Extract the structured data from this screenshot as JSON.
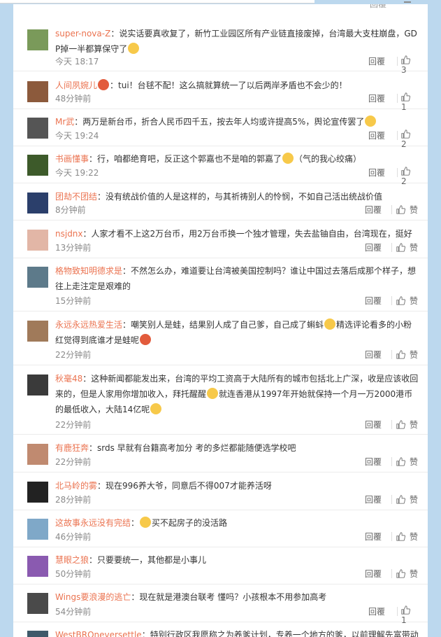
{
  "comments": [
    {
      "name": "super-nova-Z",
      "text": "：说实话要真收复了，新竹工业园区所有产业链直接废掉，台湾最大支柱崩盘，GDP掉一半都算保守了",
      "time": "今天 18:17",
      "reply": "回覆",
      "likes": "3",
      "avatar_color": "#7a9a5a",
      "emoji": "cry"
    },
    {
      "name": "人间夙婉儿",
      "text": "：tui！台毬不配！这么搞就算统一了以后两岸矛盾也不会少的！",
      "time": "48分钟前",
      "reply": "回覆",
      "likes": "1",
      "avatar_color": "#8c5a3c",
      "badge": "vip"
    },
    {
      "name": "Mr武",
      "text": "：两万是新台币，折合人民币四千五，按去年人均或许提高5%，舆论宣传罢了",
      "time": "今天 19:24",
      "reply": "回覆",
      "likes": "2",
      "avatar_color": "#555555",
      "emoji": "sad"
    },
    {
      "name": "书画懂事",
      "text": "：行，咱都绝育吧，反正这个郭嘉也不是咱的郭嘉了",
      "tail": "（气的我心绞痛）",
      "time": "今天 19:22",
      "reply": "回覆",
      "likes": "2",
      "avatar_color": "#3d5a2a",
      "emoji": "smile"
    },
    {
      "name": "团劫不团结",
      "text": "：没有统战价值的人是这样的，与其祈祷别人的怜悯，不如自己活出统战价值",
      "time": "8分钟前",
      "reply": "回覆",
      "likes": "赞",
      "avatar_color": "#2b3f6b"
    },
    {
      "name": "nsjdnx",
      "text": "：人家才看不上这2万台币，用2万台币换一个独才管理，失去盐铀自由，台湾现在，挺好",
      "time": "13分钟前",
      "reply": "回覆",
      "likes": "赞",
      "avatar_color": "#e2b6a6"
    },
    {
      "name": "格物致知明德求是",
      "text": "：不然怎么办，难道要让台湾被美国控制吗？谁让中国过去落后成那个样子，想往上走注定是艰难的",
      "time": "15分钟前",
      "reply": "回覆",
      "likes": "赞",
      "avatar_color": "#5d7a8a"
    },
    {
      "name": "永远永远热爱生活",
      "text": "：嘲笑别人是蛙，结果别人成了自己爹，自己成了蝌蚪",
      "text2": "精选评论看多的小粉红觉得到底谁才是蛙呢",
      "time": "22分钟前",
      "reply": "回覆",
      "likes": "赞",
      "avatar_color": "#a07a5a",
      "emoji": "laugh",
      "emoji2": "frog"
    },
    {
      "name": "秋毫48",
      "text": "：这种新闻都能发出来，台湾的平均工资高于大陆所有的城市包括北上广深，收是应该收回来的，但是人家用你增加收入，拜托醒醒",
      "text2": "就连香港从1997年开始就保持一个月一万2000港币的最低收入，大陆14亿呢",
      "time": "22分钟前",
      "reply": "回覆",
      "likes": "赞",
      "avatar_color": "#3a3a3a",
      "emoji": "laugh",
      "emoji2": "cry"
    },
    {
      "name": "有鹿狂奔",
      "text": "：srds 早就有台籍高考加分 考的多烂都能随便选学校吧",
      "time": "22分钟前",
      "reply": "回覆",
      "likes": "赞",
      "avatar_color": "#c08a70"
    },
    {
      "name": "北马岭的雾",
      "text": "：现在996养大爷，同意后不得007才能养活呀",
      "time": "28分钟前",
      "reply": "回覆",
      "likes": "赞",
      "avatar_color": "#222222"
    },
    {
      "name": "这故事永远没有完结",
      "text": "：",
      "text2": "买不起房子的没活路",
      "time": "46分钟前",
      "reply": "回覆",
      "likes": "赞",
      "avatar_color": "#7fa8c8",
      "emoji": "cry"
    },
    {
      "name": "慧眼之狼",
      "text": "：只要要统一，其他都是小事儿",
      "time": "50分钟前",
      "reply": "回覆",
      "likes": "赞",
      "avatar_color": "#8a5ab0"
    },
    {
      "name": "Wings要浪漫的逃亡",
      "text": "：现在就是港澳台联考 懂吗？小孩根本不用参加高考",
      "time": "54分钟前",
      "reply": "回覆",
      "likes": "1",
      "avatar_color": "#4a4a4a"
    },
    {
      "name": "WestBROneversettle",
      "text": "：特别行政区我愿称之为养爹计划，专养一个地方的爹，以前理解先富带动后",
      "time": "",
      "reply": "",
      "likes": "",
      "avatar_color": "#3f5a6a"
    }
  ],
  "partial_top": {
    "reply": "回覆"
  }
}
